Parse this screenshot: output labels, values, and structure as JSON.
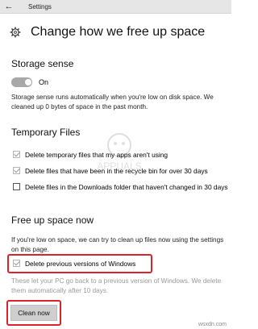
{
  "titlebar": {
    "back_glyph": "←",
    "title": "Settings"
  },
  "header": {
    "icon": "gear-icon",
    "title": "Change how we free up space"
  },
  "storage_sense": {
    "heading": "Storage sense",
    "toggle_state": "On",
    "description": "Storage sense runs automatically when you're low on disk space. We cleaned up 0 bytes of space in the past month."
  },
  "temporary_files": {
    "heading": "Temporary Files",
    "items": [
      {
        "label": "Delete temporary files that my apps aren't using",
        "checked": true
      },
      {
        "label": "Delete files that have been in the recycle bin for over 30 days",
        "checked": true
      },
      {
        "label": "Delete files in the Downloads folder that haven't changed in 30 days",
        "checked": false
      }
    ]
  },
  "free_up_space": {
    "heading": "Free up space now",
    "description": "If you're low on space, we can try to clean up files now using the settings on this page.",
    "previous_windows": {
      "label": "Delete previous versions of Windows",
      "checked": true
    },
    "note": "These let your PC go back to a previous version of Windows. We delete them automatically after 10 days.",
    "button_label": "Clean now"
  },
  "watermark": {
    "site": "wsxdn.com",
    "logo_text": "APPUALS"
  },
  "colors": {
    "highlight": "#d9232d",
    "toggle_off": "#a8a8a8",
    "button_bg": "#cfcfcf"
  }
}
